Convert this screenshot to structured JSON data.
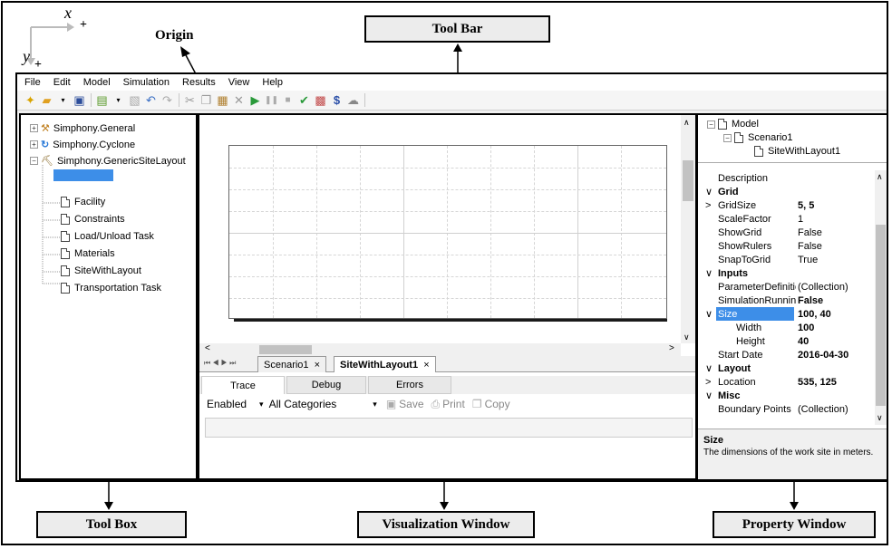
{
  "annotations": {
    "axis_x": "x",
    "axis_y": "y",
    "axis_plus_x": "+",
    "axis_plus_y": "+",
    "origin": "Origin",
    "toolbar_callout": "Tool Bar",
    "toolbox_callout": "Tool Box",
    "visualization_callout": "Visualization Window",
    "property_callout": "Property Window"
  },
  "menu": [
    "File",
    "Edit",
    "Model",
    "Simulation",
    "Results",
    "View",
    "Help"
  ],
  "toolbar_icons": [
    "new-icon",
    "open-icon",
    "save-icon",
    "add-element-icon",
    "properties-icon",
    "undo-icon",
    "redo-icon",
    "cut-icon",
    "copy-icon",
    "paste-icon",
    "delete-icon",
    "run-icon",
    "pause-icon",
    "stop-icon",
    "check-icon",
    "report-icon",
    "cost-icon",
    "cloud-icon"
  ],
  "toolbox": {
    "nodes": [
      {
        "label": "Simphony.General"
      },
      {
        "label": "Simphony.Cyclone"
      },
      {
        "label": "Simphony.GenericSiteLayout"
      }
    ],
    "children": [
      "Facility",
      "Constraints",
      "Load/Unload Task",
      "Materials",
      "SiteWithLayout",
      "Transportation Task"
    ]
  },
  "viz": {
    "tabs": [
      {
        "label": "Scenario1",
        "close": "×"
      },
      {
        "label": "SiteWithLayout1",
        "close": "×"
      }
    ],
    "output_tabs": [
      "Trace",
      "Debug",
      "Errors"
    ],
    "output_toolbar": {
      "enabled": "Enabled",
      "categories": "All Categories",
      "save": "Save",
      "print": "Print",
      "copy": "Copy"
    }
  },
  "property": {
    "tree": [
      "Model",
      "Scenario1",
      "SiteWithLayout1"
    ],
    "rows": [
      {
        "name": "Description",
        "value": ""
      },
      {
        "name": "Grid",
        "value": "",
        "category": true
      },
      {
        "name": "GridSize",
        "value": "5, 5",
        "expander": ">",
        "bold": true
      },
      {
        "name": "ScaleFactor",
        "value": "1"
      },
      {
        "name": "ShowGrid",
        "value": "False"
      },
      {
        "name": "ShowRulers",
        "value": "False"
      },
      {
        "name": "SnapToGrid",
        "value": "True"
      },
      {
        "name": "Inputs",
        "value": "",
        "category": true
      },
      {
        "name": "ParameterDefinitic",
        "value": "(Collection)"
      },
      {
        "name": "SimulationRunning",
        "value": "False",
        "bold": true
      },
      {
        "name": "Size",
        "value": "100, 40",
        "bold": true,
        "selected": true
      },
      {
        "name": "Width",
        "value": "100",
        "bold": true,
        "indent": true
      },
      {
        "name": "Height",
        "value": "40",
        "bold": true,
        "indent": true
      },
      {
        "name": "Start Date",
        "value": "2016-04-30",
        "bold": true
      },
      {
        "name": "Layout",
        "value": "",
        "category": true
      },
      {
        "name": "Location",
        "value": "535, 125",
        "expander": ">",
        "bold": true
      },
      {
        "name": "Misc",
        "value": "",
        "category": true
      },
      {
        "name": "Boundary Points",
        "value": "(Collection)"
      }
    ],
    "help_title": "Size",
    "help_text": "The dimensions of the work site in meters."
  },
  "colors": {
    "selection": "#3d8ee8",
    "frame": "#000000",
    "callout_bg": "#ececec"
  }
}
